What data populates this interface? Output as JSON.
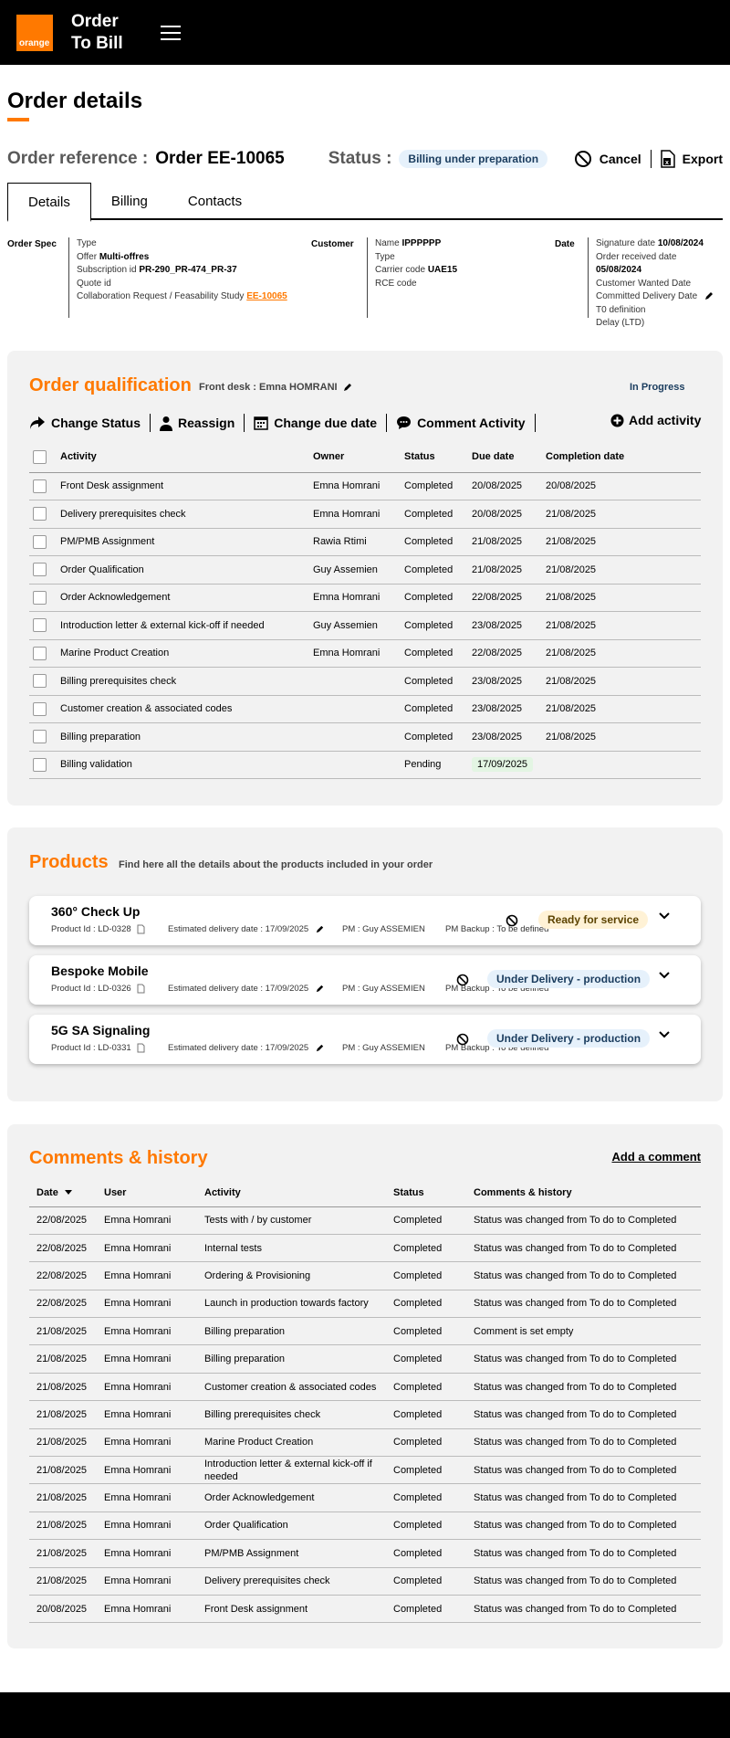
{
  "header": {
    "logo_text": "orange",
    "app_title_line1": "Order",
    "app_title_line2": "To Bill",
    "brand_color": "#ff7900"
  },
  "page": {
    "title": "Order details"
  },
  "order": {
    "reference_label": "Order reference :",
    "reference_value": "Order EE-10065",
    "status_label": "Status :",
    "status_value": "Billing under preparation",
    "cancel_label": "Cancel",
    "export_label": "Export"
  },
  "tabs": [
    {
      "label": "Details"
    },
    {
      "label": "Billing"
    },
    {
      "label": "Contacts"
    }
  ],
  "spec": {
    "order_spec_heading": "Order Spec",
    "type_label": "Type",
    "offer_label": "Offer",
    "offer_value": "Multi-offres",
    "subscription_label": "Subscription id",
    "subscription_value": "PR-290_PR-474_PR-37",
    "quote_label": "Quote id",
    "collab_label": "Collaboration Request / Feasability Study",
    "collab_link": "EE-10065",
    "customer_heading": "Customer",
    "name_label": "Name",
    "name_value": "IPPPPPP",
    "ctype_label": "Type",
    "carrier_label": "Carrier code",
    "carrier_value": "UAE15",
    "rce_label": "RCE code",
    "date_heading": "Date",
    "signature_label": "Signature date",
    "signature_value": "10/08/2024",
    "received_label": "Order received date",
    "received_value": "05/08/2024",
    "wanted_label": "Customer Wanted Date",
    "committed_label": "Committed Delivery Date",
    "t0_label": "T0 definition",
    "delay_label": "Delay (LTD)"
  },
  "qualification": {
    "title": "Order qualification",
    "front_desk": "Front desk : Emna HOMRANI",
    "progress": "In Progress",
    "toolbar": {
      "change_status": "Change Status",
      "reassign": "Reassign",
      "change_due": "Change due date",
      "comment": "Comment Activity",
      "add": "Add activity"
    },
    "columns": {
      "activity": "Activity",
      "owner": "Owner",
      "status": "Status",
      "due": "Due date",
      "completion": "Completion date"
    },
    "rows": [
      {
        "activity": "Front Desk assignment",
        "owner": "Emna Homrani",
        "status": "Completed",
        "due": "20/08/2025",
        "completion": "20/08/2025"
      },
      {
        "activity": "Delivery prerequisites check",
        "owner": "Emna Homrani",
        "status": "Completed",
        "due": "20/08/2025",
        "completion": "21/08/2025"
      },
      {
        "activity": "PM/PMB Assignment",
        "owner": "Rawia Rtimi",
        "status": "Completed",
        "due": "21/08/2025",
        "completion": "21/08/2025"
      },
      {
        "activity": "Order Qualification",
        "owner": "Guy Assemien",
        "status": "Completed",
        "due": "21/08/2025",
        "completion": "21/08/2025"
      },
      {
        "activity": "Order Acknowledgement",
        "owner": "Emna Homrani",
        "status": "Completed",
        "due": "22/08/2025",
        "completion": "21/08/2025"
      },
      {
        "activity": "Introduction letter & external kick-off if needed",
        "owner": "Guy Assemien",
        "status": "Completed",
        "due": "23/08/2025",
        "completion": "21/08/2025"
      },
      {
        "activity": "Marine Product Creation",
        "owner": "Emna Homrani",
        "status": "Completed",
        "due": "22/08/2025",
        "completion": "21/08/2025"
      },
      {
        "activity": "Billing prerequisites check",
        "owner": "",
        "status": "Completed",
        "due": "23/08/2025",
        "completion": "21/08/2025"
      },
      {
        "activity": "Customer creation & associated codes",
        "owner": "",
        "status": "Completed",
        "due": "23/08/2025",
        "completion": "21/08/2025"
      },
      {
        "activity": "Billing preparation",
        "owner": "",
        "status": "Completed",
        "due": "23/08/2025",
        "completion": "21/08/2025"
      },
      {
        "activity": "Billing validation",
        "owner": "",
        "status": "Pending",
        "due": "17/09/2025",
        "completion": ""
      }
    ]
  },
  "products": {
    "title": "Products",
    "subtitle": "Find here all the details about the products included in your order",
    "items": [
      {
        "name": "360° Check Up",
        "product_id": "Product Id :  LD-0328",
        "delivery": "Estimated delivery date :  17/09/2025",
        "pm": "PM :  Guy ASSEMIEN",
        "pm_backup": "PM Backup :  To be defined",
        "status": "Ready for service"
      },
      {
        "name": "Bespoke Mobile",
        "product_id": "Product Id :  LD-0326",
        "delivery": "Estimated delivery date :  17/09/2025",
        "pm": "PM :  Guy ASSEMIEN",
        "pm_backup": "PM Backup :  To be defined",
        "status": "Under Delivery - production"
      },
      {
        "name": "5G SA Signaling",
        "product_id": "Product Id :  LD-0331",
        "delivery": "Estimated delivery date :  17/09/2025",
        "pm": "PM :  Guy ASSEMIEN",
        "pm_backup": "PM Backup :  To be defined",
        "status": "Under Delivery - production"
      }
    ]
  },
  "history": {
    "title": "Comments & history",
    "add_comment": "Add a comment",
    "columns": {
      "date": "Date",
      "user": "User",
      "activity": "Activity",
      "status": "Status",
      "comments": "Comments & history"
    },
    "rows": [
      {
        "date": "22/08/2025",
        "user": "Emna Homrani",
        "activity": "Tests with / by customer",
        "status": "Completed",
        "comment": "Status was changed from To do to Completed"
      },
      {
        "date": "22/08/2025",
        "user": "Emna Homrani",
        "activity": "Internal tests",
        "status": "Completed",
        "comment": "Status was changed from To do to Completed"
      },
      {
        "date": "22/08/2025",
        "user": "Emna Homrani",
        "activity": "Ordering & Provisioning",
        "status": "Completed",
        "comment": "Status was changed from To do to Completed"
      },
      {
        "date": "22/08/2025",
        "user": "Emna Homrani",
        "activity": "Launch in production towards factory",
        "status": "Completed",
        "comment": "Status was changed from To do to Completed"
      },
      {
        "date": "21/08/2025",
        "user": "Emna Homrani",
        "activity": "Billing preparation",
        "status": "Completed",
        "comment": "Comment is set empty"
      },
      {
        "date": "21/08/2025",
        "user": "Emna Homrani",
        "activity": "Billing preparation",
        "status": "Completed",
        "comment": "Status was changed from To do to Completed"
      },
      {
        "date": "21/08/2025",
        "user": "Emna Homrani",
        "activity": "Customer creation & associated codes",
        "status": "Completed",
        "comment": "Status was changed from To do to Completed"
      },
      {
        "date": "21/08/2025",
        "user": "Emna Homrani",
        "activity": "Billing prerequisites check",
        "status": "Completed",
        "comment": "Status was changed from To do to Completed"
      },
      {
        "date": "21/08/2025",
        "user": "Emna Homrani",
        "activity": "Marine Product Creation",
        "status": "Completed",
        "comment": "Status was changed from To do to Completed"
      },
      {
        "date": "21/08/2025",
        "user": "Emna Homrani",
        "activity": "Introduction letter & external kick-off if needed",
        "status": "Completed",
        "comment": "Status was changed from To do to Completed"
      },
      {
        "date": "21/08/2025",
        "user": "Emna Homrani",
        "activity": "Order Acknowledgement",
        "status": "Completed",
        "comment": "Status was changed from To do to Completed"
      },
      {
        "date": "21/08/2025",
        "user": "Emna Homrani",
        "activity": "Order Qualification",
        "status": "Completed",
        "comment": "Status was changed from To do to Completed"
      },
      {
        "date": "21/08/2025",
        "user": "Emna Homrani",
        "activity": "PM/PMB Assignment",
        "status": "Completed",
        "comment": "Status was changed from To do to Completed"
      },
      {
        "date": "21/08/2025",
        "user": "Emna Homrani",
        "activity": "Delivery prerequisites check",
        "status": "Completed",
        "comment": "Status was changed from To do to Completed"
      },
      {
        "date": "20/08/2025",
        "user": "Emna Homrani",
        "activity": "Front Desk assignment",
        "status": "Completed",
        "comment": "Status was changed from To do to Completed"
      }
    ]
  }
}
